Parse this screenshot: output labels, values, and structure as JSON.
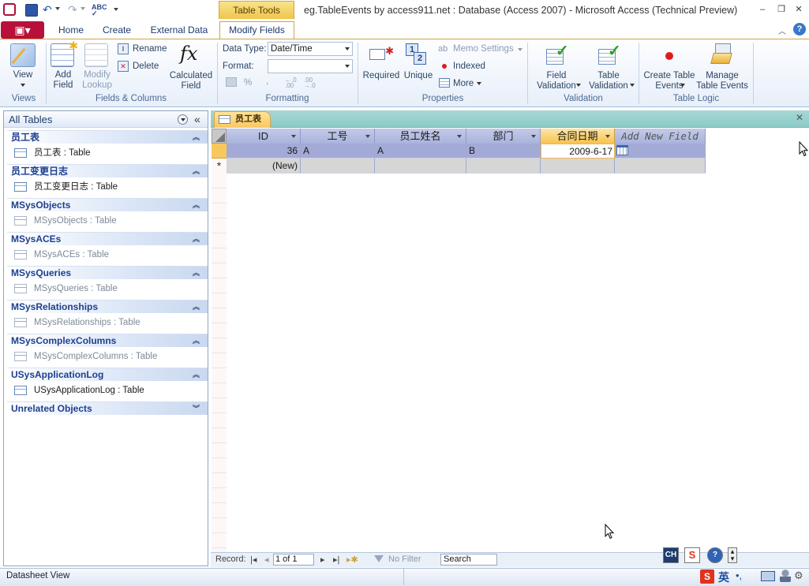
{
  "window": {
    "title": "eg.TableEvents by access911.net : Database (Access 2007)  -  Microsoft Access (Technical Preview)",
    "contextual_tab_group": "Table Tools",
    "min": "–",
    "max": "❐",
    "close": "✕"
  },
  "tabs": [
    "Home",
    "Create",
    "External Data",
    "Modify Fields"
  ],
  "ribbon": {
    "views": {
      "view_label": "View",
      "group": "Views"
    },
    "fields_columns": {
      "add_field": "Add\nField",
      "modify_lookup": "Modify\nLookup",
      "rename": "Rename",
      "delete": "Delete",
      "calculated_field": "Calculated\nField",
      "group": "Fields & Columns"
    },
    "formatting": {
      "data_type_label": "Data Type:",
      "data_type_value": "Date/Time",
      "format_label": "Format:",
      "format_value": "",
      "percent": "%",
      "comma": ",",
      "group": "Formatting"
    },
    "properties": {
      "required": "Required",
      "unique": "Unique",
      "memo_settings": "Memo Settings",
      "indexed": "Indexed",
      "more": "More",
      "group": "Properties"
    },
    "validation": {
      "field_validation": "Field\nValidation",
      "table_validation": "Table\nValidation",
      "group": "Validation"
    },
    "table_logic": {
      "create_events": "Create Table\nEvents",
      "manage_events": "Manage\nTable Events",
      "group": "Table Logic"
    }
  },
  "nav": {
    "header": "All Tables",
    "collapse": "«",
    "groups": [
      {
        "name": "员工表",
        "items": [
          {
            "label": "员工表 : Table",
            "dim": false
          }
        ]
      },
      {
        "name": "员工变更日志",
        "items": [
          {
            "label": "员工变更日志 : Table",
            "dim": false
          }
        ]
      },
      {
        "name": "MSysObjects",
        "items": [
          {
            "label": "MSysObjects : Table",
            "dim": true
          }
        ]
      },
      {
        "name": "MSysACEs",
        "items": [
          {
            "label": "MSysACEs : Table",
            "dim": true
          }
        ]
      },
      {
        "name": "MSysQueries",
        "items": [
          {
            "label": "MSysQueries : Table",
            "dim": true
          }
        ]
      },
      {
        "name": "MSysRelationships",
        "items": [
          {
            "label": "MSysRelationships : Table",
            "dim": true
          }
        ]
      },
      {
        "name": "MSysComplexColumns",
        "items": [
          {
            "label": "MSysComplexColumns : Table",
            "dim": true
          }
        ]
      },
      {
        "name": "USysApplicationLog",
        "items": [
          {
            "label": "USysApplicationLog : Table",
            "dim": false
          }
        ]
      },
      {
        "name": "Unrelated Objects",
        "items": []
      }
    ]
  },
  "document": {
    "tab_label": "员工表",
    "columns": [
      "ID",
      "工号",
      "员工姓名",
      "部门",
      "合同日期",
      "Add New Field"
    ],
    "rows": [
      [
        "36",
        "A",
        "A",
        "B",
        "2009-6-17",
        ""
      ]
    ],
    "new_row": "(New)",
    "new_row_marker": "*"
  },
  "record_nav": {
    "label": "Record:",
    "position": "1 of 1",
    "filter": "No Filter",
    "search": "Search"
  },
  "statusbar": {
    "left": "Datasheet View",
    "ime_mode": "英",
    "ime_ch": "CH"
  },
  "colors": {
    "accent_orange": "#f8c85c",
    "row_selected": "#a3aad6",
    "header": "#b5bee0",
    "doc_tabbar": "#9dd2cf"
  }
}
